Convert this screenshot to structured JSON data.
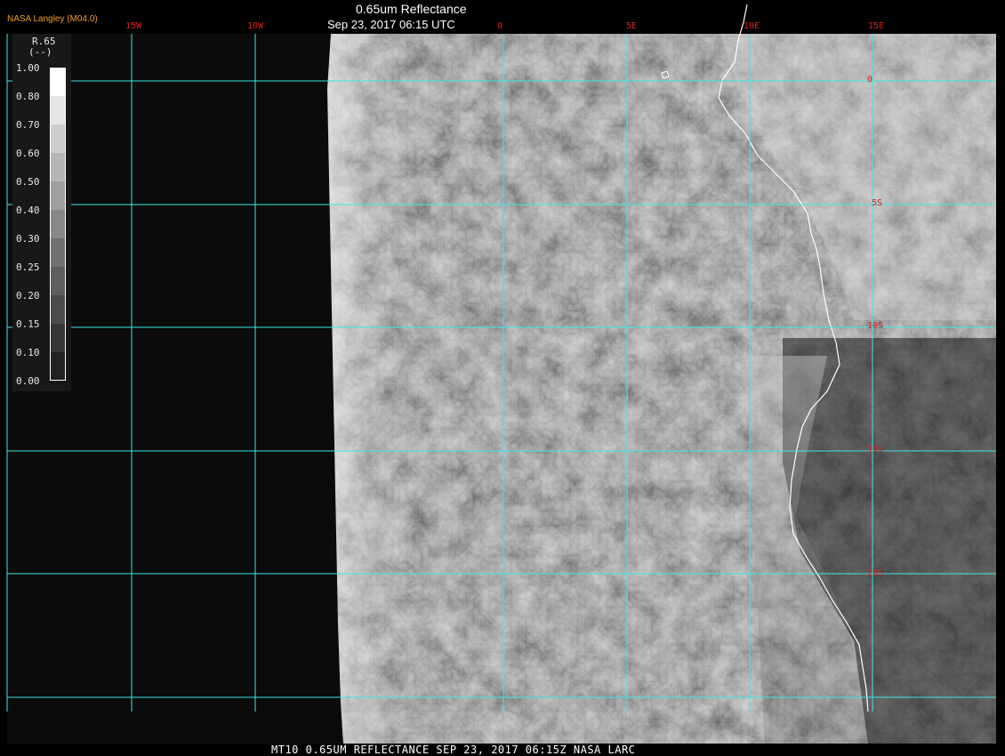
{
  "header": {
    "credit": "NASA Langley (M04.0)",
    "title": "0.65um Reflectance",
    "subtitle": "Sep 23, 2017 06:15 UTC"
  },
  "footer": {
    "text": "MT10  0.65UM REFLECTANCE   SEP 23, 2017 06:15Z   NASA LARC"
  },
  "map": {
    "longitude_labels": [
      "15W",
      "10W",
      "0",
      "5E",
      "10E",
      "15E"
    ],
    "latitude_labels": [
      "0",
      "5S",
      "10S",
      "15S",
      "20S"
    ],
    "grid_color": "#3ee6e6",
    "label_color": "#d42020",
    "coastline_color": "#ffffff"
  },
  "colorbar": {
    "name": "R.65",
    "unit": "(--)",
    "ticks": [
      "1.00",
      "0.80",
      "0.70",
      "0.60",
      "0.50",
      "0.40",
      "0.30",
      "0.25",
      "0.20",
      "0.15",
      "0.10",
      "0.00"
    ],
    "shades": [
      "#ffffff",
      "#e6e6e6",
      "#cdcdcd",
      "#b6b6b6",
      "#9f9f9f",
      "#888888",
      "#727272",
      "#5e5e5e",
      "#4a4a4a",
      "#363636",
      "#222222"
    ]
  }
}
